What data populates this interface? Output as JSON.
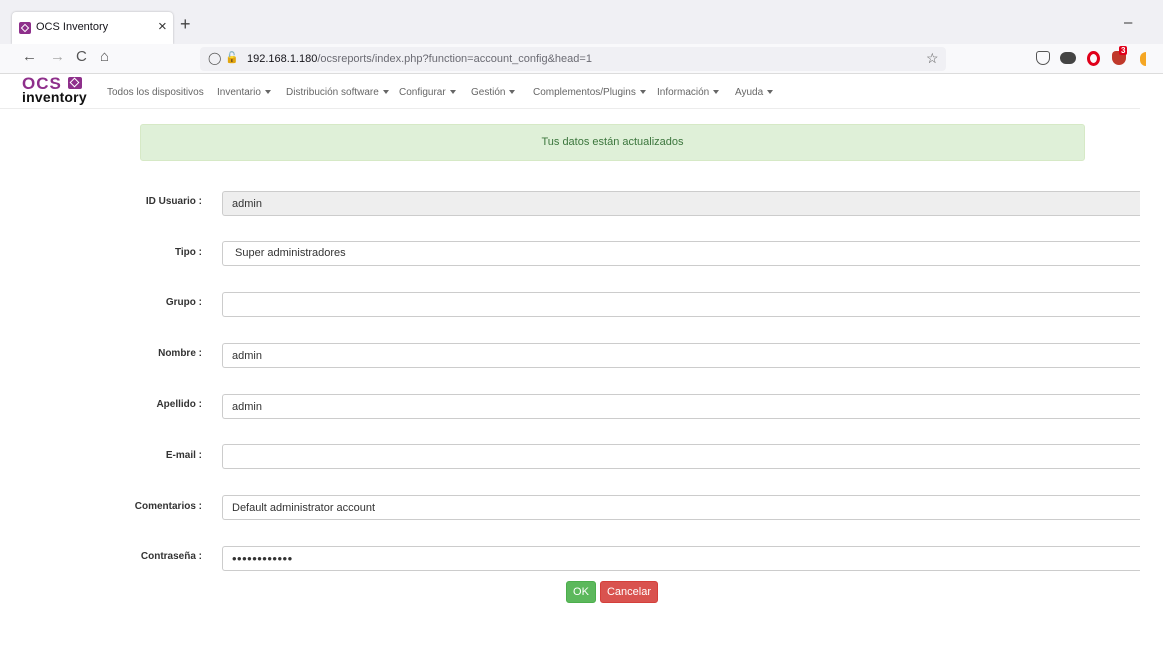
{
  "browser": {
    "tab_title": "OCS Inventory",
    "tab_close": "×",
    "new_tab": "+",
    "minimize": "–",
    "url_host": "192.168.1.180",
    "url_path": "/ocsreports/index.php?function=account_config&head=1",
    "back": "←",
    "forward": "→",
    "reload": "C",
    "home": "⌂",
    "extension_badge": "3"
  },
  "app": {
    "logo_top": "OCS",
    "logo_bottom": "inventory",
    "menu": [
      {
        "label": "Todos los dispositivos",
        "dropdown": false
      },
      {
        "label": "Inventario",
        "dropdown": true
      },
      {
        "label": "Distribución software",
        "dropdown": true
      },
      {
        "label": "Configurar",
        "dropdown": true
      },
      {
        "label": "Gestión",
        "dropdown": true
      },
      {
        "label": "Complementos/Plugins",
        "dropdown": true
      },
      {
        "label": "Información",
        "dropdown": true
      },
      {
        "label": "Ayuda",
        "dropdown": true
      }
    ]
  },
  "alert": {
    "message": "Tus datos están actualizados"
  },
  "form": {
    "user_id": {
      "label": "ID Usuario :",
      "value": "admin"
    },
    "type": {
      "label": "Tipo :",
      "value": "Super administradores"
    },
    "group": {
      "label": "Grupo :",
      "value": ""
    },
    "first_name": {
      "label": "Nombre :",
      "value": "admin"
    },
    "last_name": {
      "label": "Apellido :",
      "value": "admin"
    },
    "email": {
      "label": "E-mail :",
      "value": ""
    },
    "comments": {
      "label": "Comentarios :",
      "value": "Default administrator account"
    },
    "password": {
      "label": "Contraseña :",
      "value": "••••••••••••"
    }
  },
  "buttons": {
    "ok": "OK",
    "cancel": "Cancelar"
  },
  "colors": {
    "brand": "#8e2f8b",
    "success_bg": "#dff0d8",
    "success_text": "#3c763d",
    "ok_button": "#5cb85c",
    "cancel_button": "#d9534f"
  }
}
